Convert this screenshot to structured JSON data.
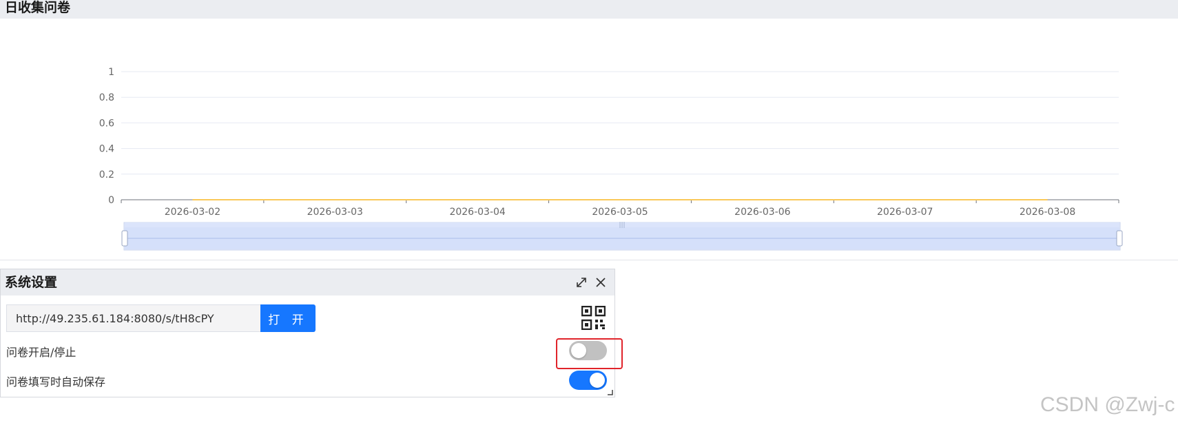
{
  "chart_panel": {
    "title": "日收集问卷"
  },
  "chart_data": {
    "type": "line",
    "categories": [
      "2026-03-02",
      "2026-03-03",
      "2026-03-04",
      "2026-03-05",
      "2026-03-06",
      "2026-03-07",
      "2026-03-08"
    ],
    "series": [
      {
        "values": [
          0,
          0,
          0,
          0,
          0,
          0,
          0
        ],
        "color": "#fac858"
      }
    ],
    "y_ticks": [
      "0",
      "0.2",
      "0.4",
      "0.6",
      "0.8",
      "1"
    ],
    "ylim": [
      0,
      1
    ],
    "grid": true,
    "datazoom_slider": true
  },
  "settings": {
    "title": "系统设置",
    "url_value": "http://49.235.61.184:8080/s/tH8cPY",
    "open_button": "打 开",
    "toggle_open_label": "问卷开启/停止",
    "toggle_open_on": false,
    "toggle_autosave_label": "问卷填写时自动保存",
    "toggle_autosave_on": true
  },
  "watermark": "CSDN @Zwj-c",
  "colors": {
    "accent": "#1677ff",
    "highlight": "#e0232a",
    "switch_off": "#c1c1c1"
  }
}
